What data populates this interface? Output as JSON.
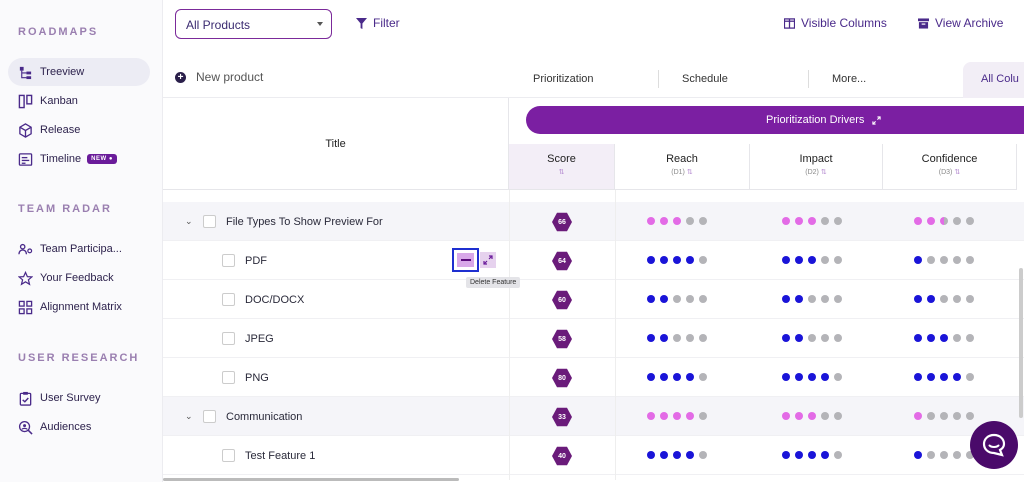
{
  "sidebar": {
    "sections": [
      {
        "title": "ROADMAPS",
        "items": [
          {
            "label": "Treeview",
            "icon": "treeview-icon",
            "active": true
          },
          {
            "label": "Kanban",
            "icon": "kanban-icon"
          },
          {
            "label": "Release",
            "icon": "cube-icon"
          },
          {
            "label": "Timeline",
            "icon": "timeline-icon",
            "badge": "NEW"
          }
        ]
      },
      {
        "title": "TEAM RADAR",
        "items": [
          {
            "label": "Team Participa...",
            "icon": "team-participation-icon"
          },
          {
            "label": "Your Feedback",
            "icon": "star-icon"
          },
          {
            "label": "Alignment Matrix",
            "icon": "matrix-icon"
          }
        ]
      },
      {
        "title": "USER RESEARCH",
        "items": [
          {
            "label": "User Survey",
            "icon": "clipboard-check-icon"
          },
          {
            "label": "Audiences",
            "icon": "search-people-icon"
          }
        ]
      }
    ]
  },
  "toolbar": {
    "product_select": "All Products",
    "filter_label": "Filter",
    "visible_columns_label": "Visible Columns",
    "view_archive_label": "View Archive"
  },
  "tabs": {
    "new_product": "New product",
    "items": [
      "Prioritization",
      "Schedule",
      "More..."
    ],
    "active": "All Colu"
  },
  "table": {
    "title_header": "Title",
    "drivers_label": "Prioritization Drivers",
    "columns": [
      {
        "name": "Score",
        "sub": ""
      },
      {
        "name": "Reach",
        "sub": "(D1)"
      },
      {
        "name": "Impact",
        "sub": "(D2)"
      },
      {
        "name": "Confidence",
        "sub": "(D3)"
      }
    ],
    "rows": [
      {
        "label": "File Types To Show Preview For",
        "group": true,
        "score": "66",
        "dots": [
          [
            "p",
            "p",
            "p",
            "g",
            "g"
          ],
          [
            "p",
            "p",
            "p",
            "g",
            "g"
          ],
          [
            "p",
            "p",
            "h",
            "g",
            "g"
          ]
        ]
      },
      {
        "label": "PDF",
        "group": false,
        "score": "64",
        "dots": [
          [
            "b",
            "b",
            "b",
            "b",
            "g"
          ],
          [
            "b",
            "b",
            "b",
            "g",
            "g"
          ],
          [
            "b",
            "g",
            "g",
            "g",
            "g"
          ]
        ]
      },
      {
        "label": "DOC/DOCX",
        "group": false,
        "score": "60",
        "dots": [
          [
            "b",
            "b",
            "g",
            "g",
            "g"
          ],
          [
            "b",
            "b",
            "g",
            "g",
            "g"
          ],
          [
            "b",
            "b",
            "g",
            "g",
            "g"
          ]
        ]
      },
      {
        "label": "JPEG",
        "group": false,
        "score": "58",
        "dots": [
          [
            "b",
            "b",
            "g",
            "g",
            "g"
          ],
          [
            "b",
            "b",
            "g",
            "g",
            "g"
          ],
          [
            "b",
            "b",
            "b",
            "g",
            "g"
          ]
        ]
      },
      {
        "label": "PNG",
        "group": false,
        "score": "80",
        "dots": [
          [
            "b",
            "b",
            "b",
            "b",
            "g"
          ],
          [
            "b",
            "b",
            "b",
            "b",
            "g"
          ],
          [
            "b",
            "b",
            "b",
            "b",
            "g"
          ]
        ]
      },
      {
        "label": "Communication",
        "group": true,
        "score": "33",
        "dots": [
          [
            "p",
            "p",
            "p",
            "p",
            "g"
          ],
          [
            "p",
            "p",
            "p",
            "g",
            "g"
          ],
          [
            "p",
            "g",
            "g",
            "g",
            "g"
          ]
        ]
      },
      {
        "label": "Test Feature 1",
        "group": false,
        "score": "40",
        "dots": [
          [
            "b",
            "b",
            "b",
            "b",
            "g"
          ],
          [
            "b",
            "b",
            "b",
            "b",
            "g"
          ],
          [
            "b",
            "g",
            "g",
            "g",
            "g"
          ]
        ]
      }
    ]
  },
  "tooltip": "Delete Feature",
  "colors": {
    "accent": "#7b1fa2",
    "dot_blue": "#1a14d8",
    "dot_pink": "#e36be6",
    "dot_gray": "#b4b4b8",
    "score_hex": "#6a1b7a"
  }
}
